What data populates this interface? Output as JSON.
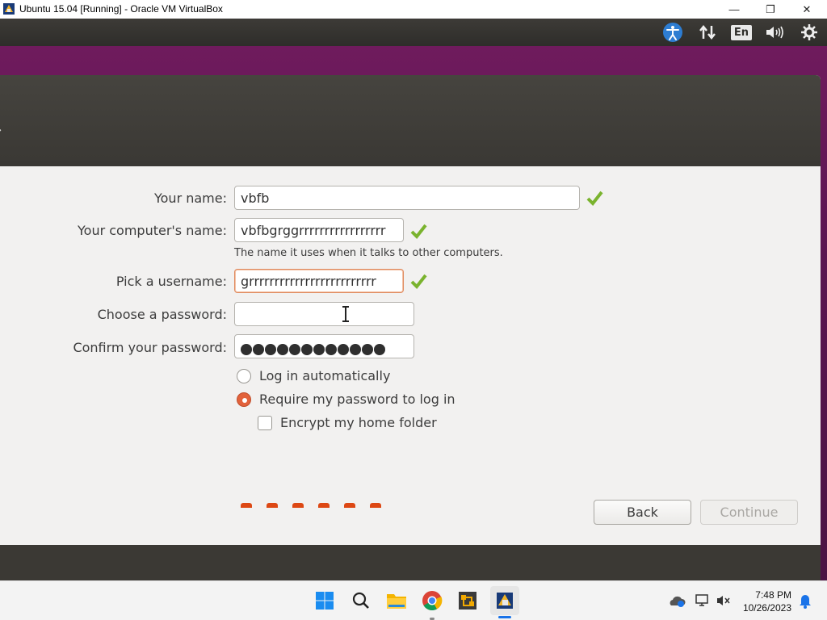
{
  "host_window": {
    "title": "Ubuntu 15.04 [Running] - Oracle VM VirtualBox",
    "minimize": "—",
    "restore": "❐",
    "close": "✕"
  },
  "ubuntu_panel": {
    "language": "En",
    "icons": [
      "accessibility-icon",
      "network-icon",
      "keyboard-language-indicator",
      "volume-icon",
      "settings-icon"
    ]
  },
  "installer": {
    "fields": {
      "your_name": {
        "label": "Your name:",
        "value": "vbfb"
      },
      "computer_name": {
        "label": "Your computer's name:",
        "value": "vbfbgrggrrrrrrrrrrrrrrrrr",
        "hint": "The name it uses when it talks to other computers."
      },
      "username": {
        "label": "Pick a username:",
        "value": "grrrrrrrrrrrrrrrrrrrrrrrrr"
      },
      "password": {
        "label": "Choose a password:",
        "value": ""
      },
      "confirm_password": {
        "label": "Confirm your password:",
        "masked_length": 12
      }
    },
    "options": {
      "login_auto": "Log in automatically",
      "require_password": "Require my password to log in",
      "encrypt_home": "Encrypt my home folder",
      "selected": "require_password",
      "encrypt_checked": false
    },
    "buttons": {
      "back": "Back",
      "continue": "Continue"
    },
    "colors": {
      "accent": "#dd4814",
      "check": "#7ab32e"
    }
  },
  "taskbar": {
    "time": "7:48 PM",
    "date": "10/26/2023",
    "apps": [
      "windows-start-icon",
      "search-icon",
      "file-explorer-icon",
      "chrome-icon",
      "vmware-icon",
      "virtualbox-icon"
    ]
  }
}
